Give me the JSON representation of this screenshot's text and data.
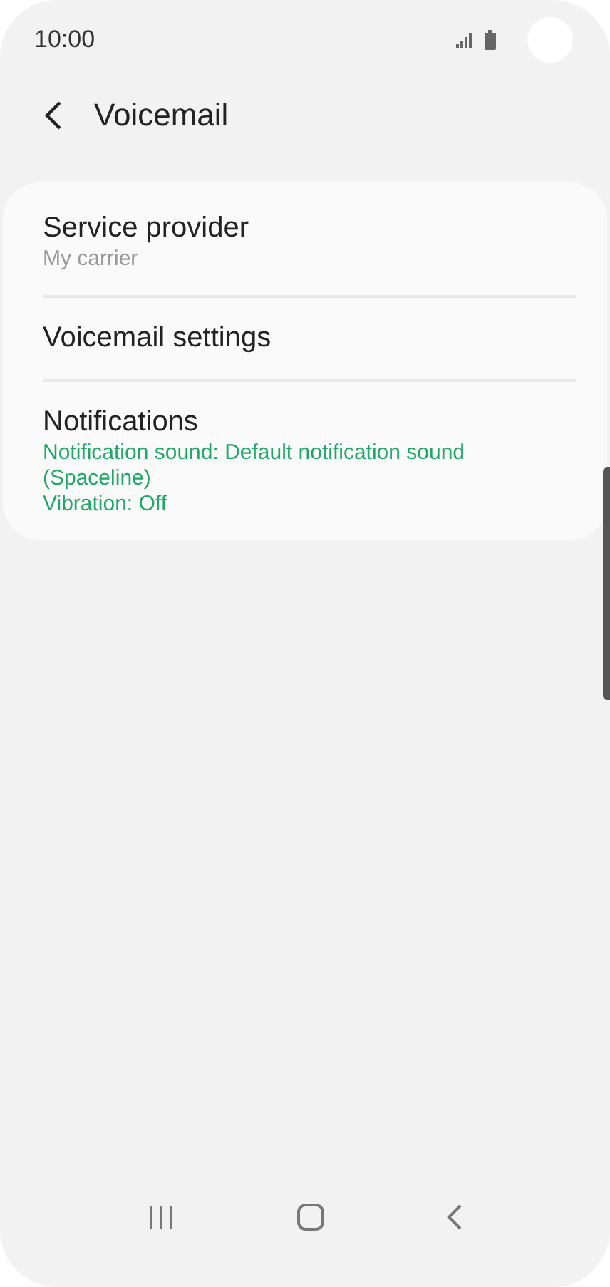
{
  "status_bar": {
    "time": "10:00"
  },
  "header": {
    "title": "Voicemail"
  },
  "items": [
    {
      "title": "Service provider",
      "kind": "muted",
      "summary": [
        "My carrier"
      ]
    },
    {
      "title": "Voicemail settings",
      "kind": "plain"
    },
    {
      "title": "Notifications",
      "kind": "accent",
      "summary": [
        "Notification sound: Default notification sound (Spaceline)",
        "Vibration: Off"
      ]
    }
  ]
}
